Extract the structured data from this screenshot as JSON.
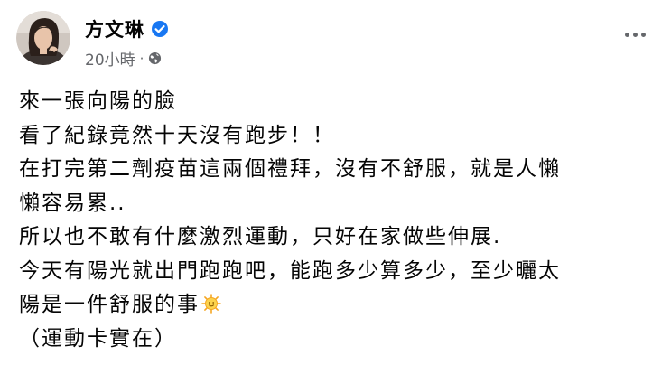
{
  "post": {
    "author": "方文琳",
    "timestamp": "20小時",
    "separator": "·",
    "privacy_icon": "globe-icon",
    "verified_icon": "verified-badge-icon",
    "more_icon": "more-options-icon",
    "accent_color": "#1877f2",
    "secondary_text_color": "#65676b",
    "lines": [
      "來一張向陽的臉",
      "看了紀錄竟然十天沒有跑步！！",
      "在打完第二劑疫苗這兩個禮拜，沒有不舒服，就是人懶",
      "懶容易累..",
      "所以也不敢有什麼激烈運動，只好在家做些伸展.",
      "今天有陽光就出門跑跑吧，能跑多少算多少，至少曬太",
      "陽是一件舒服的事",
      "（運動卡實在）"
    ],
    "inline_emoji": "sun-with-face-emoji"
  }
}
